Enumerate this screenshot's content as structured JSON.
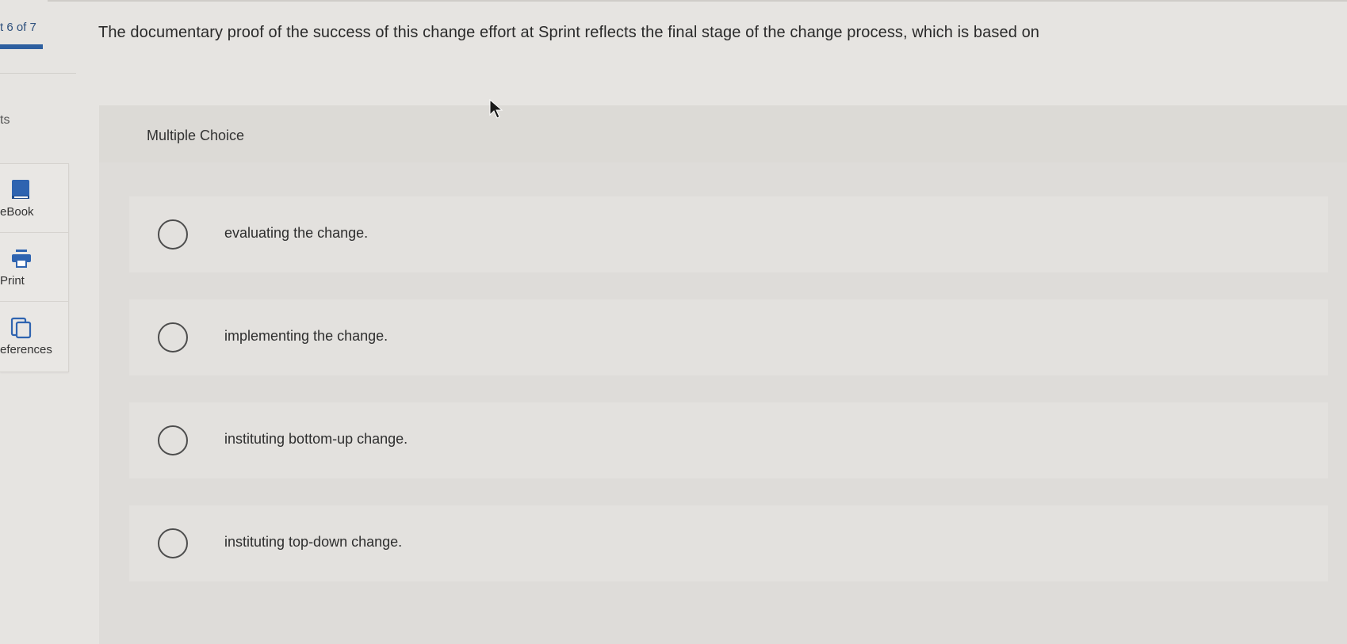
{
  "progress": {
    "label": "t 6 of 7",
    "fraction": 0.857
  },
  "sidebar": {
    "points_label": "ts",
    "tools": [
      {
        "label": "eBook",
        "icon": "book-icon"
      },
      {
        "label": "Print",
        "icon": "printer-icon"
      },
      {
        "label": "eferences",
        "icon": "references-icon"
      }
    ]
  },
  "question": {
    "text": "The documentary proof of the success of this change effort at Sprint reflects the final stage of the change process, which is based on"
  },
  "card": {
    "type_label": "Multiple Choice",
    "options": [
      {
        "text": "evaluating the change.",
        "selected": false
      },
      {
        "text": "implementing the change.",
        "selected": false
      },
      {
        "text": "instituting bottom-up change.",
        "selected": false
      },
      {
        "text": "instituting top-down change.",
        "selected": false
      }
    ]
  },
  "colors": {
    "accent": "#2d5fa0",
    "background": "#e6e4e1"
  }
}
